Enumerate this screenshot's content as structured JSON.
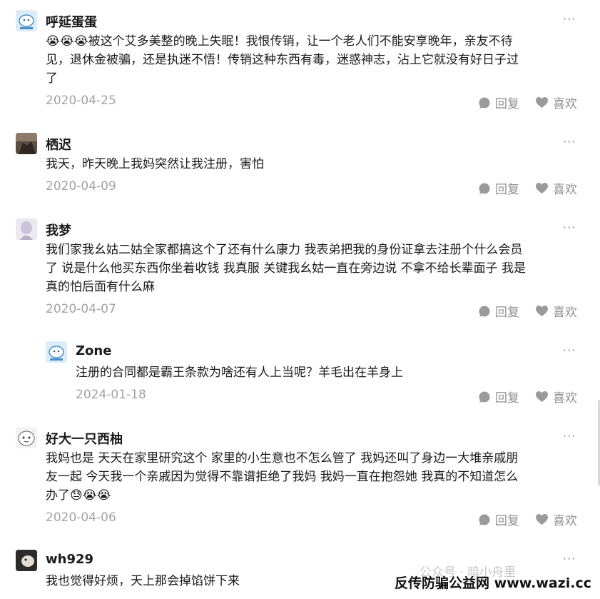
{
  "ui": {
    "more": "···",
    "reply": "回复",
    "like": "喜欢"
  },
  "comments": [
    {
      "name": "呼延蛋蛋",
      "lines": [
        "😭😭😭被这个艾多美整的晚上失眠！我恨传销，让一个老人们不能安享晚年，亲友不待",
        "见，退休金被骗，还是执迷不悟！传销这种东西有毒，迷惑神志，沾上它就没有好日子过",
        "了"
      ],
      "date": "2020-04-25"
    },
    {
      "name": "栖迟",
      "lines": [
        "我天，昨天晚上我妈突然让我注册，害怕"
      ],
      "date": "2020-04-09"
    },
    {
      "name": "我梦",
      "lines": [
        "我们家我幺姑二姑全家都搞这个了还有什么康力 我表弟把我的身份证拿去注册个什么会员",
        "了 说是什么他买东西你坐着收钱 我真服 关键我幺姑一直在旁边说 不拿不给长辈面子 我是",
        "真的怕后面有什么麻"
      ],
      "date": "2020-04-07"
    },
    {
      "name": "Zone",
      "lines": [
        "注册的合同都是霸王条款为啥还有人上当呢？羊毛出在羊身上"
      ],
      "date": "2024-01-18"
    },
    {
      "name": "好大一只西柚",
      "lines": [
        "我妈也是 天天在家里研究这个 家里的小生意也不怎么管了 我妈还叫了身边一大堆亲戚朋",
        "友一起 今天我一个亲戚因为觉得不靠谱拒绝了我妈 我妈一直在抱怨她 我真的不知道怎么",
        "办了😓😭😭"
      ],
      "date": "2020-04-06"
    },
    {
      "name": "wh929",
      "lines": [
        "我也觉得好烦，天上那会掉馅饼下来"
      ],
      "date": ""
    }
  ],
  "watermark": {
    "faint": "公众号 · 暗小舟里",
    "text": "反传防骗公益网 www.wazi.cc"
  },
  "colors": {
    "text": "#1a1a1a",
    "muted": "#a3a3a3",
    "action": "#8f8f8f",
    "icon": "#9a9a9a"
  }
}
